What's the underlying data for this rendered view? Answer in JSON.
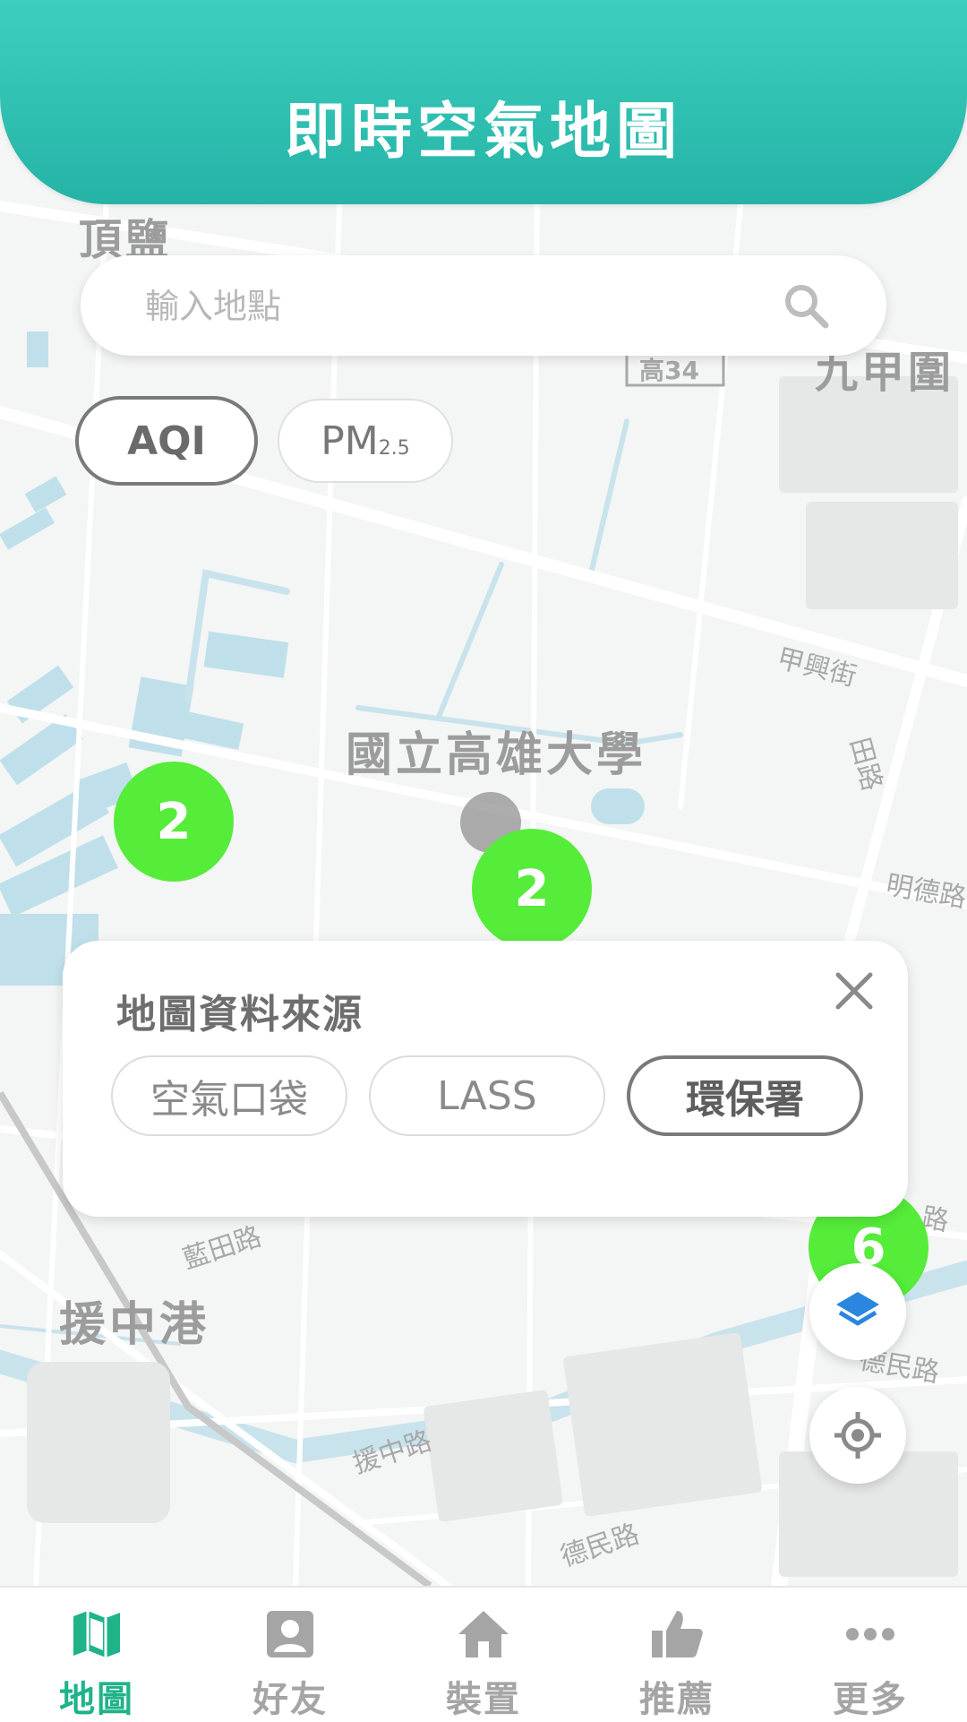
{
  "header": {
    "title": "即時空氣地圖"
  },
  "search": {
    "placeholder": "輸入地點"
  },
  "metric_toggle": {
    "aqi_label": "AQI",
    "pm_label": "PM",
    "pm_sub": "2.5",
    "selected": "AQI"
  },
  "map": {
    "place_labels": [
      "頂鹽",
      "國立高雄大學",
      "援中港",
      "九甲圍"
    ],
    "road_labels": [
      "高34",
      "甲興街",
      "明德路",
      "藍田路",
      "援中路",
      "德民路",
      "田路",
      "德民路",
      "路"
    ],
    "clusters": [
      {
        "count": "2",
        "color": "#55ec3a"
      },
      {
        "count": "2",
        "color": "#55ec3a"
      },
      {
        "count": "6",
        "color": "#55ec3a"
      }
    ],
    "pin_color": "#e8453c"
  },
  "data_source_panel": {
    "title": "地圖資料來源",
    "sources": [
      "空氣口袋",
      "LASS",
      "環保署"
    ],
    "selected": "環保署"
  },
  "nav": {
    "items": [
      {
        "label": "地圖",
        "icon": "map-icon",
        "active": true
      },
      {
        "label": "好友",
        "icon": "person-icon",
        "active": false
      },
      {
        "label": "裝置",
        "icon": "home-icon",
        "active": false
      },
      {
        "label": "推薦",
        "icon": "thumbs-up-icon",
        "active": false
      },
      {
        "label": "更多",
        "icon": "more-icon",
        "active": false
      }
    ]
  },
  "colors": {
    "header_gradient_top": "#3ccfbe",
    "header_gradient_bottom": "#25b3a6",
    "active_tab": "#1fb38a",
    "cluster": "#55ec3a"
  }
}
